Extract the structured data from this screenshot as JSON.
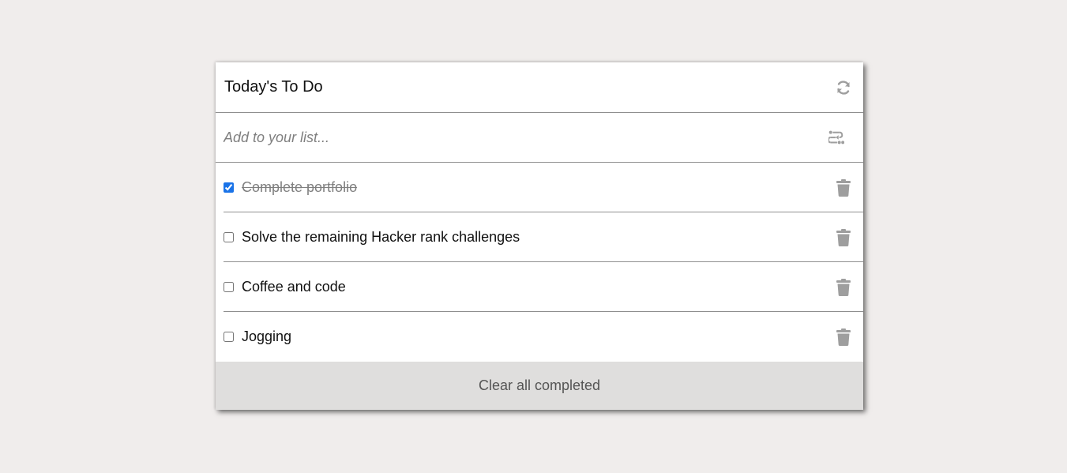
{
  "header": {
    "title": "Today's To Do",
    "refresh_icon": "refresh-icon"
  },
  "add": {
    "placeholder": "Add to your list...",
    "submit_icon": "enter-return-icon"
  },
  "todos": [
    {
      "text": "Complete portfolio",
      "completed": true
    },
    {
      "text": "Solve the remaining Hacker rank challenges",
      "completed": false
    },
    {
      "text": "Coffee and code",
      "completed": false
    },
    {
      "text": "Jogging",
      "completed": false
    }
  ],
  "footer": {
    "clear_label": "Clear all completed"
  },
  "colors": {
    "background": "#f0edec",
    "icon": "#9e9e9e",
    "footer_bg": "#dfdedd",
    "checkbox_accent": "#1a73e8"
  }
}
